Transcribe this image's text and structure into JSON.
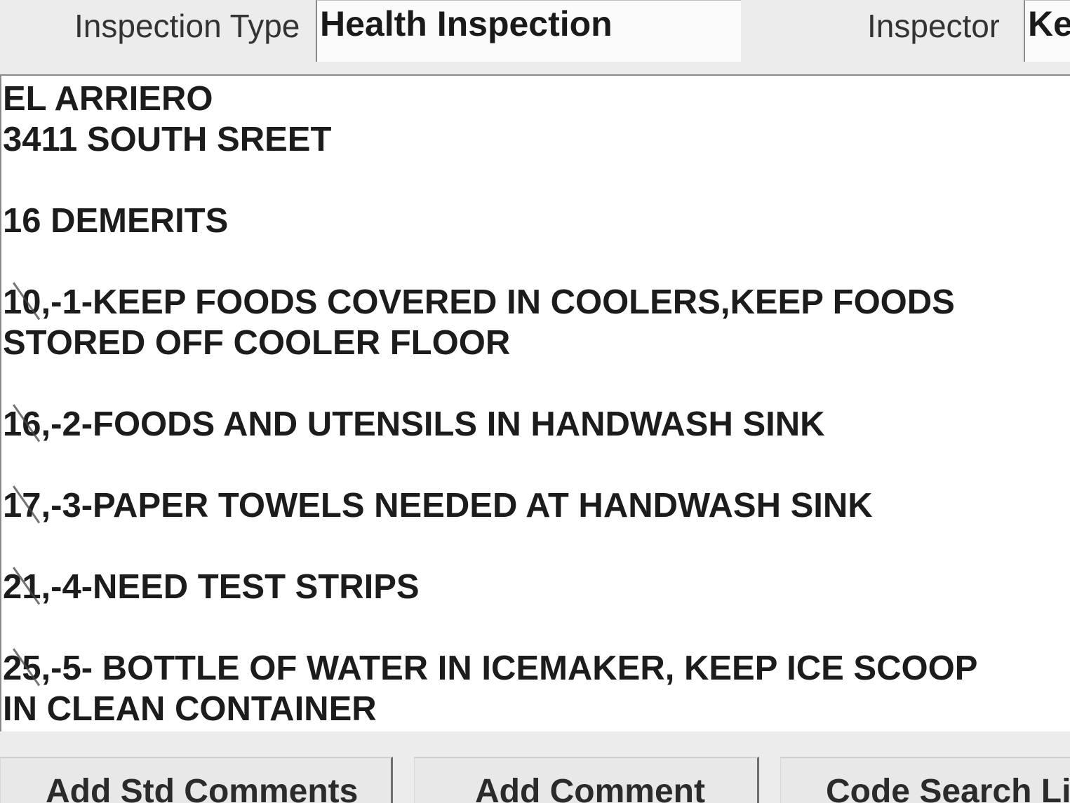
{
  "header": {
    "inspection_type_label": "Inspection Type",
    "inspection_type_value": "Health Inspection",
    "inspector_label": "Inspector",
    "inspector_value": "Ke"
  },
  "comments": {
    "establishment_name": "EL ARRIERO",
    "address": "3411 SOUTH SREET",
    "demerits": "16 DEMERITS",
    "items": [
      {
        "code": "10",
        "text": ",-1-KEEP FOODS COVERED IN COOLERS,KEEP FOODS STORED OFF COOLER FLOOR"
      },
      {
        "code": "16",
        "text": ",-2-FOODS AND UTENSILS IN HANDWASH SINK"
      },
      {
        "code": "17",
        "text": ",-3-PAPER TOWELS NEEDED AT HANDWASH SINK"
      },
      {
        "code": "21",
        "text": ",-4-NEED TEST STRIPS"
      },
      {
        "code": "25",
        "text": ",-5- BOTTLE OF WATER IN ICEMAKER, KEEP ICE SCOOP IN CLEAN CONTAINER"
      }
    ]
  },
  "buttons": {
    "add_std_comments": "Add Std Comments",
    "add_comment": "Add Comment",
    "code_search": "Code Search Li"
  }
}
